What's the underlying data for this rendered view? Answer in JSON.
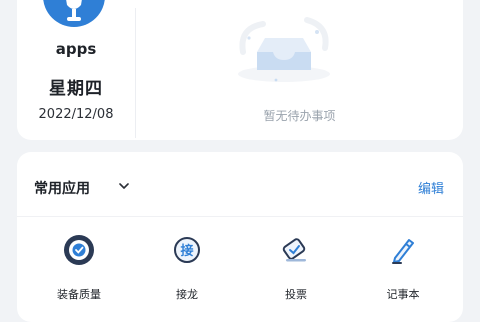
{
  "profile": {
    "app_name": "apps",
    "weekday": "星期四",
    "date": "2022/12/08"
  },
  "todo": {
    "empty_text": "暂无待办事项"
  },
  "apps": {
    "title": "常用应用",
    "edit_label": "编辑",
    "items": [
      {
        "label": "装备质量",
        "icon": "quality-seal-icon"
      },
      {
        "label": "接龙",
        "icon": "relay-icon"
      },
      {
        "label": "投票",
        "icon": "vote-icon"
      },
      {
        "label": "记事本",
        "icon": "notepad-pen-icon"
      }
    ]
  },
  "colors": {
    "accent": "#2f7fd6",
    "background": "#f1f3f6",
    "card": "#ffffff"
  }
}
